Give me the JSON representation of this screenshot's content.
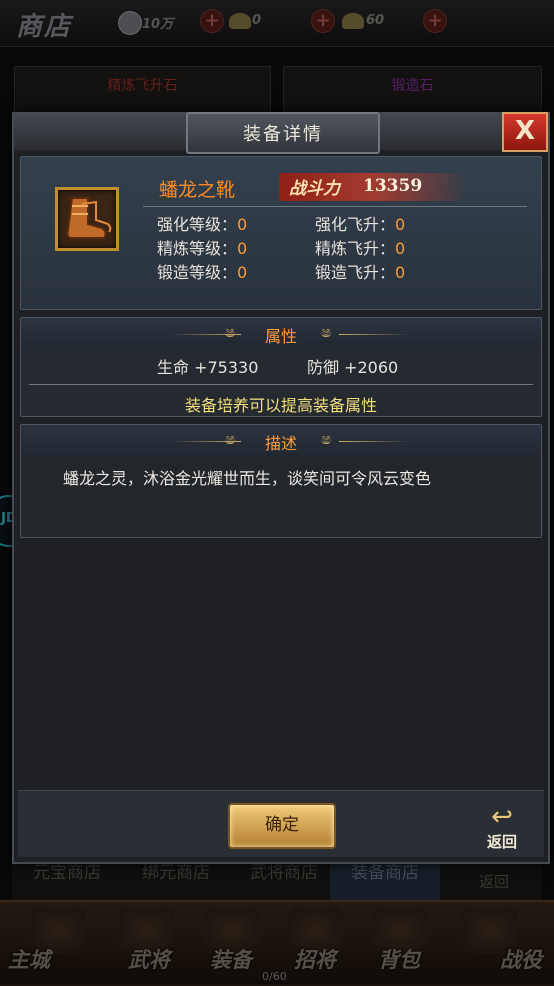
{
  "shop": {
    "title": "商店",
    "resources": [
      {
        "icon": "silver-coin-icon",
        "value": "10万"
      },
      {
        "icon": "gold-ingot-icon",
        "value": "0"
      },
      {
        "icon": "gold-ingot-icon",
        "value": "60"
      }
    ],
    "cards": [
      {
        "name": "精炼飞升石",
        "color": "#a0322a"
      },
      {
        "name": "锻造石",
        "color": "#8a2fa0"
      }
    ],
    "tabs": [
      "元宝商店",
      "绑元商店",
      "武将商店",
      "装备商店",
      "返回"
    ],
    "nav": [
      "主城",
      "武将",
      "装备",
      "招将",
      "背包",
      "战役"
    ],
    "bag_count": "0/60"
  },
  "dialog": {
    "title": "装备详情",
    "close_label": "X",
    "item": {
      "name": "蟠龙之靴",
      "power_label": "战斗力",
      "power_value": "13359"
    },
    "stats": [
      {
        "label": "强化等级：",
        "value": "0"
      },
      {
        "label": "强化飞升：",
        "value": "0"
      },
      {
        "label": "精炼等级：",
        "value": "0"
      },
      {
        "label": "精炼飞升：",
        "value": "0"
      },
      {
        "label": "锻造等级：",
        "value": "0"
      },
      {
        "label": "锻造飞升：",
        "value": "0"
      }
    ],
    "attributes": {
      "title": "属性",
      "hp": "生命 +75330",
      "def": "防御 +2060",
      "tip": "装备培养可以提高装备属性"
    },
    "description": {
      "title": "描述",
      "text": "蟠龙之灵，沐浴金光耀世而生，谈笑间可令风云变色"
    },
    "confirm_label": "确定",
    "back_label": "返回"
  }
}
